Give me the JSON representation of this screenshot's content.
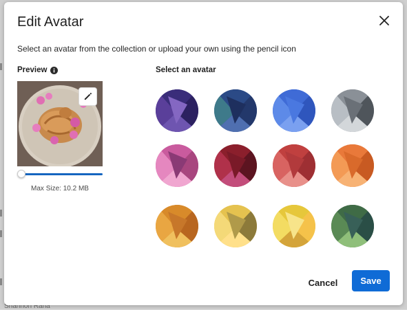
{
  "dialog": {
    "title": "Edit Avatar",
    "subtitle": "Select an avatar from the collection or upload your own using the pencil icon",
    "close_icon": "close-icon"
  },
  "preview": {
    "label": "Preview",
    "info_icon": "info-icon",
    "edit_icon": "pencil-icon",
    "zoom_level": 0,
    "max_size_text": "Max Size: 10.2 MB"
  },
  "gallery": {
    "label": "Select an avatar",
    "avatars": [
      {
        "name": "purple",
        "colors": [
          "#3a2d7a",
          "#5a3f9a",
          "#2c2160",
          "#6e55b0",
          "#8467c2"
        ]
      },
      {
        "name": "navy-teal",
        "colors": [
          "#2b4a86",
          "#3e7a8a",
          "#23386b",
          "#4f6fb0",
          "#1e2f5e"
        ]
      },
      {
        "name": "blue",
        "colors": [
          "#3f6bd6",
          "#5d8ae8",
          "#2f56bd",
          "#7aa0f0",
          "#4a78e0"
        ]
      },
      {
        "name": "gray",
        "colors": [
          "#8a9097",
          "#b8bec4",
          "#4f555b",
          "#d3d7da",
          "#6a7077"
        ]
      },
      {
        "name": "pink",
        "colors": [
          "#c95b9e",
          "#e587bf",
          "#a8467f",
          "#f0a6d0",
          "#8a3a75"
        ]
      },
      {
        "name": "crimson",
        "colors": [
          "#8b1f2c",
          "#b0314a",
          "#5c1420",
          "#c34d7b",
          "#7a1a28"
        ]
      },
      {
        "name": "red",
        "colors": [
          "#c0403f",
          "#d86361",
          "#9e2f33",
          "#e8908a",
          "#b23a3c"
        ]
      },
      {
        "name": "orange",
        "colors": [
          "#e9793a",
          "#f39a55",
          "#c85a22",
          "#f7b274",
          "#d96a2b"
        ]
      },
      {
        "name": "amber",
        "colors": [
          "#d88a2a",
          "#e9a642",
          "#b8661f",
          "#f0c05e",
          "#c7772a"
        ]
      },
      {
        "name": "gold-olive",
        "colors": [
          "#e5c24f",
          "#f4d978",
          "#8c7a3a",
          "#ffe08a",
          "#b09a4a"
        ]
      },
      {
        "name": "yellow",
        "colors": [
          "#e6c73b",
          "#f3dc62",
          "#f5c24a",
          "#d4a43a",
          "#f7e48a"
        ]
      },
      {
        "name": "green",
        "colors": [
          "#3f6b46",
          "#5a8a55",
          "#2a4e46",
          "#8fbf7a",
          "#386058"
        ]
      }
    ]
  },
  "footer": {
    "cancel_label": "Cancel",
    "save_label": "Save"
  },
  "colors": {
    "primary": "#0f6bd6",
    "slider": "#1565c0"
  },
  "background": {
    "partial_text": "Shannon Rana"
  }
}
